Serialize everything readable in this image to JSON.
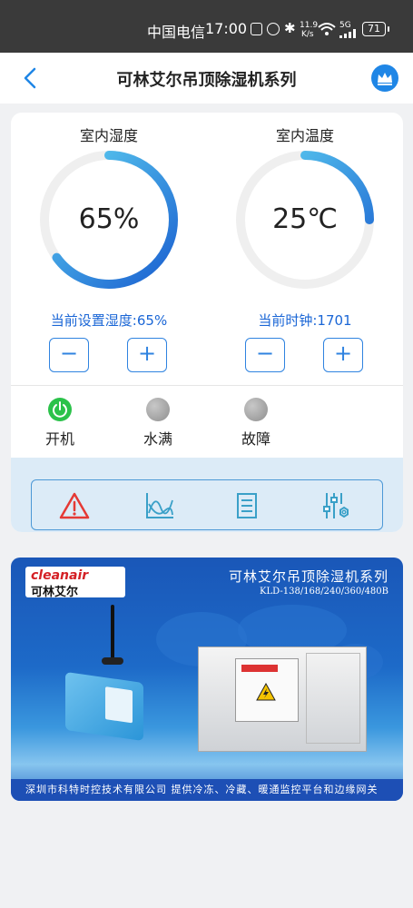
{
  "status_bar": {
    "carrier": "中国电信",
    "time": "17:00",
    "net_speed_value": "11.9",
    "net_speed_unit": "K/s",
    "signal_label": "5G",
    "battery": "71"
  },
  "header": {
    "title": "可林艾尔吊顶除湿机系列"
  },
  "humidity": {
    "label": "室内湿度",
    "value": "65%",
    "level": 0.65,
    "setpoint_text": "当前设置湿度:65%",
    "minus": "−",
    "plus": "+"
  },
  "temperature": {
    "label": "室内温度",
    "value": "25℃",
    "level": 0.25,
    "clock_text": "当前时钟:1701",
    "minus": "−",
    "plus": "+"
  },
  "status_items": [
    {
      "label": "开机",
      "state": "on",
      "color": "#2bc24a"
    },
    {
      "label": "水满",
      "state": "off",
      "color": "#9e9e9e"
    },
    {
      "label": "故障",
      "state": "off",
      "color": "#9e9e9e"
    }
  ],
  "toolbar": [
    {
      "icon": "alert-icon",
      "color": "#e53935"
    },
    {
      "icon": "chart-icon",
      "color": "#3aa0c8"
    },
    {
      "icon": "list-icon",
      "color": "#3aa0c8"
    },
    {
      "icon": "settings-sliders-icon",
      "color": "#3aa0c8"
    }
  ],
  "banner": {
    "logo_text": "cleanair",
    "logo_cn": "可林艾尔",
    "title": "可林艾尔吊顶除湿机系列",
    "models": "KLD-138/168/240/360/480B",
    "footer": "深圳市科特时控技术有限公司    提供冷冻、冷藏、暖通监控平台和边缘网关"
  },
  "colors": {
    "accent": "#1f86e6",
    "gauge_start": "#1a5fd0",
    "gauge_end": "#5fd3f2",
    "gauge_track": "#efefef"
  }
}
